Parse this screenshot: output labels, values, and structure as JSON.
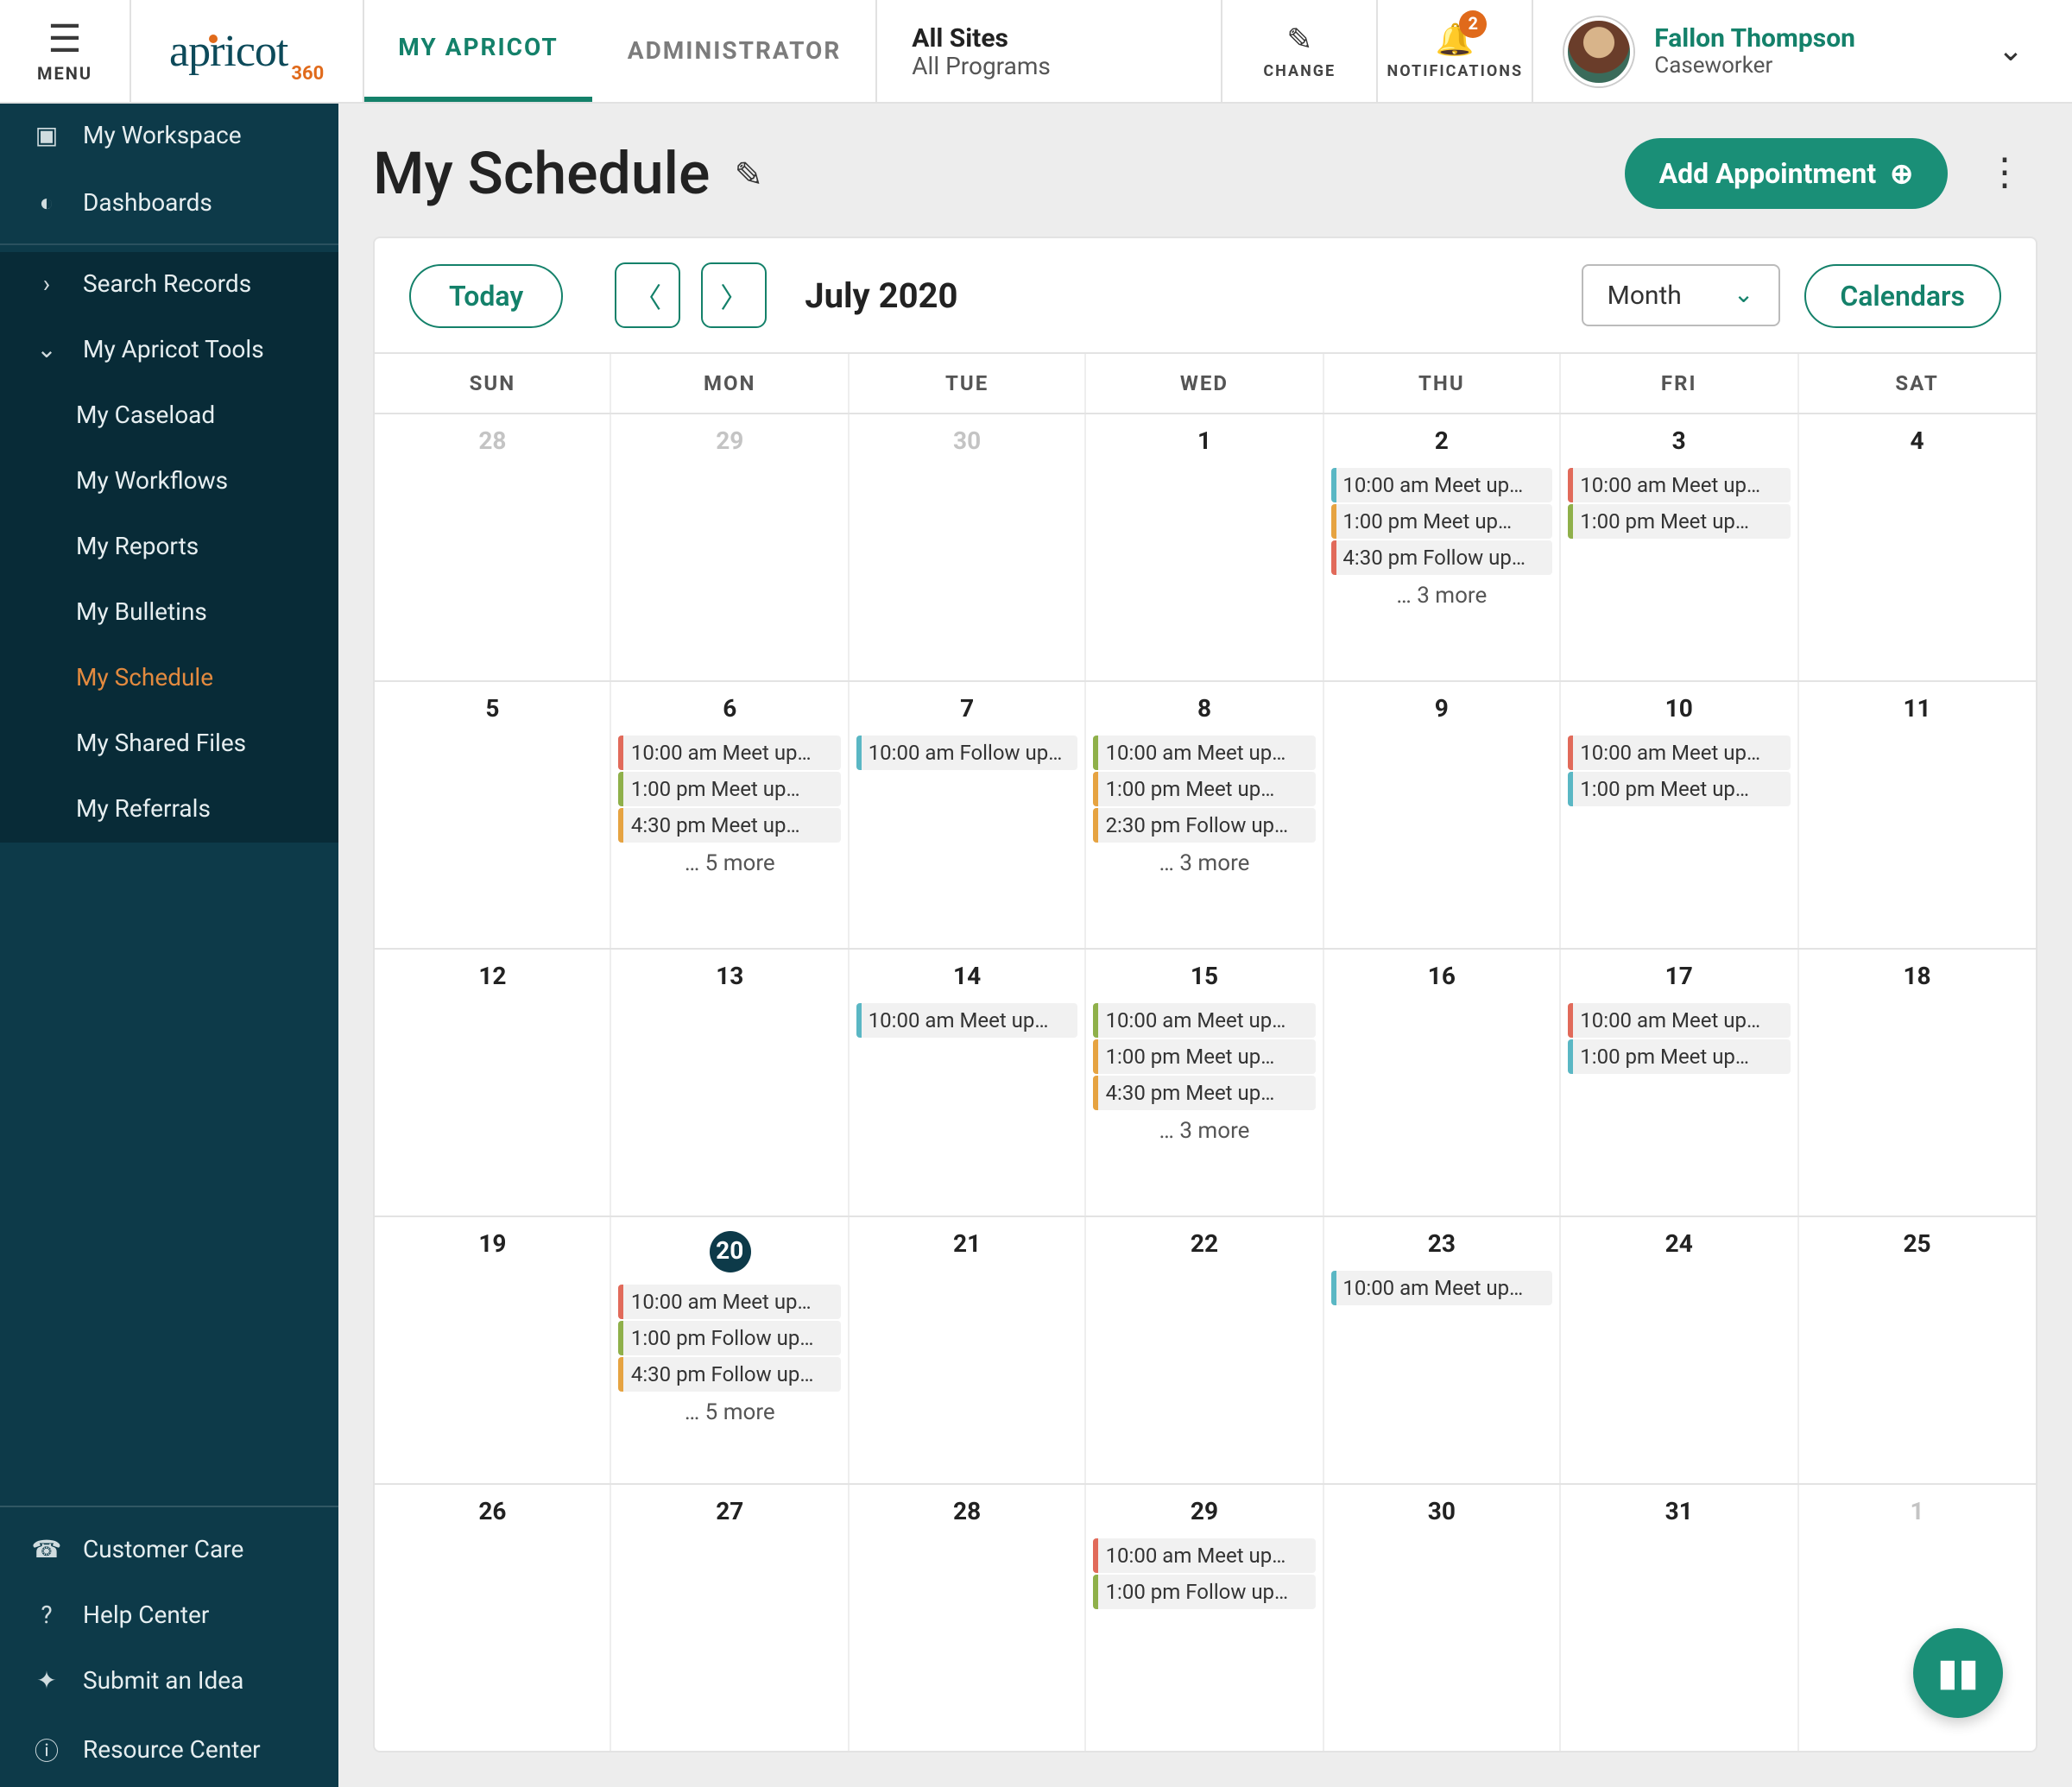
{
  "menu_label": "MENU",
  "logo": {
    "main": "apricot",
    "sub": "360"
  },
  "topnav": [
    {
      "label": "MY APRICOT",
      "active": true
    },
    {
      "label": "ADMINISTRATOR",
      "active": false
    }
  ],
  "context": {
    "line1": "All Sites",
    "line2": "All Programs"
  },
  "change_label": "CHANGE",
  "notifications": {
    "label": "NOTIFICATIONS",
    "count": "2"
  },
  "user": {
    "name": "Fallon Thompson",
    "role": "Caseworker"
  },
  "sidebar": {
    "top": [
      {
        "icon": "▣",
        "label": "My Workspace"
      },
      {
        "icon": "◐",
        "label": "Dashboards"
      }
    ],
    "search": {
      "icon": "›",
      "label": "Search Records"
    },
    "tools_header": {
      "icon": "⌄",
      "label": "My Apricot Tools"
    },
    "tools": [
      {
        "label": "My Caseload"
      },
      {
        "label": "My Workflows"
      },
      {
        "label": "My Reports"
      },
      {
        "label": "My Bulletins"
      },
      {
        "label": "My Schedule",
        "active": true
      },
      {
        "label": "My Shared Files"
      },
      {
        "label": "My Referrals"
      }
    ],
    "bottom": [
      {
        "icon": "☎",
        "label": "Customer Care"
      },
      {
        "icon": "?",
        "label": "Help Center"
      },
      {
        "icon": "✦",
        "label": "Submit an Idea"
      },
      {
        "icon": "ⓘ",
        "label": "Resource Center"
      }
    ]
  },
  "page_title": "My Schedule",
  "add_button": "Add Appointment",
  "today_button": "Today",
  "month_label": "July 2020",
  "view_select": "Month",
  "calendars_button": "Calendars",
  "dow": [
    "SUN",
    "MON",
    "TUE",
    "WED",
    "THU",
    "FRI",
    "SAT"
  ],
  "weeks": [
    [
      {
        "num": "28",
        "other": true,
        "events": []
      },
      {
        "num": "29",
        "other": true,
        "events": []
      },
      {
        "num": "30",
        "other": true,
        "events": []
      },
      {
        "num": "1",
        "events": []
      },
      {
        "num": "2",
        "events": [
          {
            "color": "teal",
            "text": "10:00 am Meet up…"
          },
          {
            "color": "orange",
            "text": "1:00 pm Meet up…"
          },
          {
            "color": "red",
            "text": "4:30 pm Follow up…"
          }
        ],
        "more": "… 3 more"
      },
      {
        "num": "3",
        "events": [
          {
            "color": "red",
            "text": "10:00 am Meet up…"
          },
          {
            "color": "green",
            "text": "1:00 pm Meet up…"
          }
        ]
      },
      {
        "num": "4",
        "events": []
      }
    ],
    [
      {
        "num": "5",
        "events": []
      },
      {
        "num": "6",
        "events": [
          {
            "color": "red",
            "text": "10:00 am Meet up…"
          },
          {
            "color": "green",
            "text": "1:00 pm Meet up…"
          },
          {
            "color": "orange",
            "text": "4:30 pm Meet up…"
          }
        ],
        "more": "… 5 more"
      },
      {
        "num": "7",
        "events": [
          {
            "color": "teal",
            "text": "10:00 am Follow up…"
          }
        ]
      },
      {
        "num": "8",
        "events": [
          {
            "color": "green",
            "text": "10:00 am Meet up…"
          },
          {
            "color": "orange",
            "text": "1:00 pm Meet up…"
          },
          {
            "color": "orange",
            "text": "2:30 pm Follow up…"
          }
        ],
        "more": "… 3 more"
      },
      {
        "num": "9",
        "events": []
      },
      {
        "num": "10",
        "events": [
          {
            "color": "red",
            "text": "10:00 am Meet up…"
          },
          {
            "color": "teal",
            "text": "1:00 pm Meet up…"
          }
        ]
      },
      {
        "num": "11",
        "events": []
      }
    ],
    [
      {
        "num": "12",
        "events": []
      },
      {
        "num": "13",
        "events": []
      },
      {
        "num": "14",
        "events": [
          {
            "color": "teal",
            "text": "10:00 am Meet up…"
          }
        ]
      },
      {
        "num": "15",
        "events": [
          {
            "color": "green",
            "text": "10:00 am Meet up…"
          },
          {
            "color": "orange",
            "text": "1:00 pm Meet up…"
          },
          {
            "color": "orange",
            "text": "4:30 pm Meet up…"
          }
        ],
        "more": "… 3 more"
      },
      {
        "num": "16",
        "events": []
      },
      {
        "num": "17",
        "events": [
          {
            "color": "red",
            "text": "10:00 am Meet up…"
          },
          {
            "color": "teal",
            "text": "1:00 pm Meet up…"
          }
        ]
      },
      {
        "num": "18",
        "events": []
      }
    ],
    [
      {
        "num": "19",
        "events": []
      },
      {
        "num": "20",
        "today": true,
        "events": [
          {
            "color": "red",
            "text": "10:00 am Meet up…"
          },
          {
            "color": "green",
            "text": "1:00 pm Follow up…"
          },
          {
            "color": "orange",
            "text": "4:30 pm Follow up…"
          }
        ],
        "more": "… 5 more"
      },
      {
        "num": "21",
        "events": []
      },
      {
        "num": "22",
        "events": []
      },
      {
        "num": "23",
        "events": [
          {
            "color": "teal",
            "text": "10:00 am Meet up…"
          }
        ]
      },
      {
        "num": "24",
        "events": []
      },
      {
        "num": "25",
        "events": []
      }
    ],
    [
      {
        "num": "26",
        "events": []
      },
      {
        "num": "27",
        "events": []
      },
      {
        "num": "28",
        "events": []
      },
      {
        "num": "29",
        "events": [
          {
            "color": "red",
            "text": "10:00 am Meet up…"
          },
          {
            "color": "green",
            "text": "1:00 pm Follow up…"
          }
        ]
      },
      {
        "num": "30",
        "events": []
      },
      {
        "num": "31",
        "events": []
      },
      {
        "num": "1",
        "other": true,
        "events": []
      }
    ]
  ]
}
